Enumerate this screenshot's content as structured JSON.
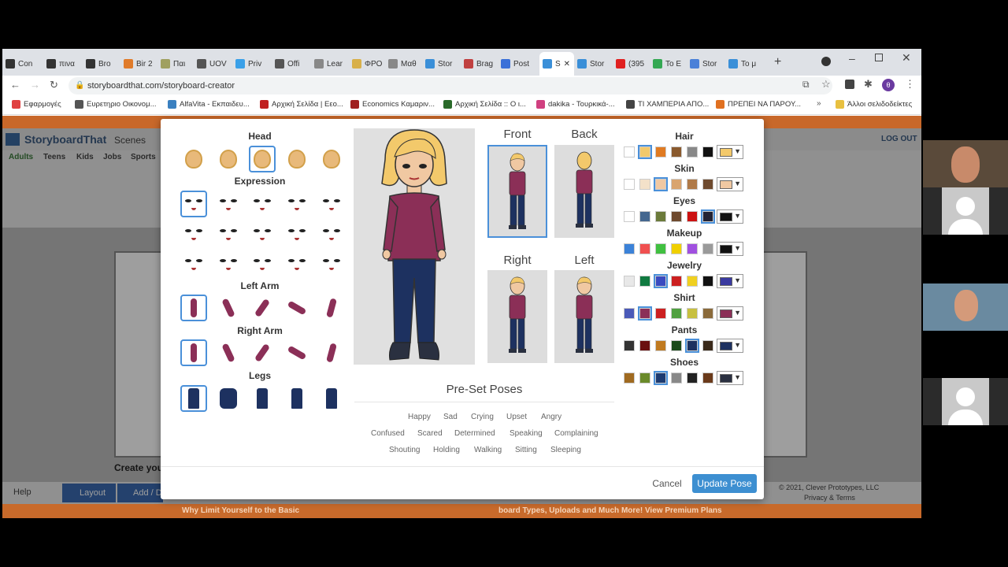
{
  "browser": {
    "tabs": [
      {
        "label": "Con",
        "color": "#333"
      },
      {
        "label": "πινα",
        "color": "#333"
      },
      {
        "label": "Bro",
        "color": "#333"
      },
      {
        "label": "Bir 2",
        "color": "#e07b2a"
      },
      {
        "label": "Παι",
        "color": "#a0a060"
      },
      {
        "label": "UOV",
        "color": "#555"
      },
      {
        "label": "Priv",
        "color": "#3aa0e8"
      },
      {
        "label": "Offi",
        "color": "#555"
      },
      {
        "label": "Lear",
        "color": "#888"
      },
      {
        "label": "ΦΡΟ",
        "color": "#d8b04a"
      },
      {
        "label": "Μαθ",
        "color": "#888"
      },
      {
        "label": "Stor",
        "color": "#3a8fd8"
      },
      {
        "label": "Brag",
        "color": "#c04040"
      },
      {
        "label": "Post",
        "color": "#3a70d8"
      },
      {
        "label": "S",
        "color": "#3a8fd8"
      },
      {
        "label": "Stor",
        "color": "#3a8fd8"
      },
      {
        "label": "(395",
        "color": "#e02020"
      },
      {
        "label": "Το Ε",
        "color": "#34a853"
      },
      {
        "label": "Stor",
        "color": "#4a80d8"
      },
      {
        "label": "Το μ",
        "color": "#3a8fd8"
      }
    ],
    "url": "storyboardthat.com/storyboard-creator",
    "bookmarks": [
      {
        "label": "Εφαρμογές",
        "color": "#e04040"
      },
      {
        "label": "Ευρετηριο Οικονομ...",
        "color": "#555"
      },
      {
        "label": "AlfaVita - Εκπαιδευ...",
        "color": "#3a80c0"
      },
      {
        "label": "Αρχική Σελίδα | Εεο...",
        "color": "#c02020"
      },
      {
        "label": "Economics Καμαριν...",
        "color": "#a02020"
      },
      {
        "label": "Αρχική Σελίδα :: Ο ι...",
        "color": "#2a6a2a"
      },
      {
        "label": "dakika - Τουρκικά-...",
        "color": "#d04080"
      },
      {
        "label": "ΤΙ ΧΑΜΠΕΡΙΑ ΑΠΟ...",
        "color": "#444"
      },
      {
        "label": "ΠΡΕΠΕΙ ΝΑ ΠΑΡΟΥ...",
        "color": "#e07020"
      },
      {
        "label": "Άλλοι σελιδοδείκτες",
        "color": "#e8c040"
      }
    ]
  },
  "sbt": {
    "logo": "StoryboardThat",
    "scenes": "Scenes",
    "logout": "LOG OUT",
    "subtabs": [
      "Adults",
      "Teens",
      "Kids",
      "Jobs",
      "Sports"
    ],
    "create_text": "Create you",
    "help": "Help",
    "layout": "Layout",
    "add": "Add / D",
    "copyright": "© 2021, Clever Prototypes, LLC",
    "privacy": "Privacy & Terms",
    "promo_left": "Why Limit Yourself to the Basic",
    "promo_right": "board Types, Uploads and Much More!   View Premium Plans"
  },
  "dialog": {
    "sections": {
      "head": "Head",
      "expression": "Expression",
      "left_arm": "Left Arm",
      "right_arm": "Right Arm",
      "legs": "Legs"
    },
    "views": {
      "front": "Front",
      "back": "Back",
      "right": "Right",
      "left": "Left"
    },
    "color_sections": {
      "hair": "Hair",
      "skin": "Skin",
      "eyes": "Eyes",
      "makeup": "Makeup",
      "jewelry": "Jewelry",
      "shirt": "Shirt",
      "pants": "Pants",
      "shoes": "Shoes"
    },
    "palettes": {
      "hair": {
        "colors": [
          "#ffffff",
          "#f3c96b",
          "#e07b22",
          "#8a5a2e",
          "#888888",
          "#111111"
        ],
        "selected": 1,
        "current": "#f3c96b"
      },
      "skin": {
        "colors": [
          "#ffffff",
          "#f3e1c9",
          "#f0c8a2",
          "#d9a46e",
          "#b07a48",
          "#6e4a2e"
        ],
        "selected": 2,
        "current": "#f0c8a2"
      },
      "eyes": {
        "colors": [
          "#ffffff",
          "#44678f",
          "#6b7a3a",
          "#6e4a2e",
          "#cc1111",
          "#222233"
        ],
        "selected": 5,
        "current": "#111111"
      },
      "makeup": {
        "colors": [
          "#3b82d8",
          "#f05050",
          "#40c040",
          "#f0d000",
          "#a050e0",
          "#9a9a9a"
        ],
        "selected": -1,
        "current": "#111111"
      },
      "jewelry": {
        "colors": [
          "#e8e8e8",
          "#107a40",
          "#3a4ac0",
          "#cc2020",
          "#f0d020",
          "#111111"
        ],
        "selected": 2,
        "current": "#3a3aa0"
      },
      "shirt": {
        "colors": [
          "#4a5ab8",
          "#8b2f57",
          "#cc2020",
          "#50a040",
          "#c8c040",
          "#8a6a3a"
        ],
        "selected": 1,
        "current": "#8b2f57"
      },
      "pants": {
        "colors": [
          "#333333",
          "#6a1010",
          "#c07a20",
          "#1a4a1a",
          "#1d3160",
          "#3a2a1a"
        ],
        "selected": 4,
        "current": "#1d3160"
      },
      "shoes": {
        "colors": [
          "#a06a20",
          "#6a8a2a",
          "#1d3a70",
          "#888888",
          "#222222",
          "#6a3a1a"
        ],
        "selected": 2,
        "current": "#2a3040"
      }
    },
    "preset_title": "Pre-Set Poses",
    "poses": [
      [
        "Happy",
        "Sad",
        "Crying",
        "Upset",
        "Angry"
      ],
      [
        "Confused",
        "Scared",
        "Determined",
        "Speaking",
        "Complaining"
      ],
      [
        "Shouting",
        "Holding",
        "Walking",
        "Sitting",
        "Sleeping"
      ]
    ],
    "cancel": "Cancel",
    "update": "Update Pose"
  }
}
